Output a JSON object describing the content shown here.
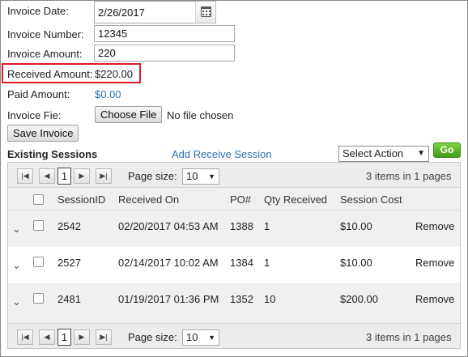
{
  "form": {
    "invoice_date_label": "Invoice Date:",
    "invoice_date_value": "2/26/2017",
    "invoice_number_label": "Invoice Number:",
    "invoice_number_value": "12345",
    "invoice_amount_label": "Invoice Amount:",
    "invoice_amount_value": "220",
    "received_amount_label": "Received Amount:",
    "received_amount_value": "$220.00",
    "paid_amount_label": "Paid Amount:",
    "paid_amount_value": "$0.00",
    "invoice_file_label": "Invoice Fie:",
    "choose_file_label": "Choose File",
    "no_file_text": "No file chosen",
    "save_button": "Save Invoice",
    "highlight_color": "#e01b24"
  },
  "sessions": {
    "title": "Existing Sessions",
    "add_link": "Add Receive Session",
    "action_select": "Select Action",
    "go_button": "Go"
  },
  "grid": {
    "pager": {
      "current_page": "1",
      "page_size_label": "Page size:",
      "page_size_value": "10",
      "summary": "3 items in 1 pages"
    },
    "columns": [
      "SessionID",
      "Received On",
      "PO#",
      "Qty Received",
      "Session Cost"
    ],
    "rows": [
      {
        "id": "2542",
        "received_on": "02/20/2017 04:53 AM",
        "po": "1388",
        "qty": "1",
        "cost": "$10.00",
        "action": "Remove"
      },
      {
        "id": "2527",
        "received_on": "02/14/2017 10:02 AM",
        "po": "1384",
        "qty": "1",
        "cost": "$10.00",
        "action": "Remove"
      },
      {
        "id": "2481",
        "received_on": "01/19/2017 01:36 PM",
        "po": "1352",
        "qty": "10",
        "cost": "$200.00",
        "action": "Remove"
      }
    ]
  },
  "icons": {
    "calendar": "calendar-icon",
    "first": "first-page-icon",
    "prev": "prev-page-icon",
    "next": "next-page-icon",
    "last": "last-page-icon",
    "expand": "chevron-down-icon",
    "dropdown": "dropdown-arrow-icon"
  },
  "colors": {
    "link": "#2a6fb0",
    "go_button": "#4caf26"
  }
}
